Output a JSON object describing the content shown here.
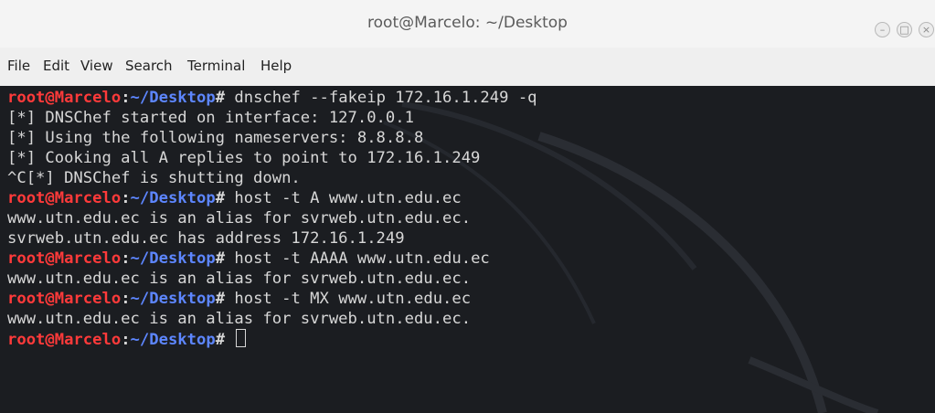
{
  "window": {
    "title": "root@Marcelo: ~/Desktop"
  },
  "controls": {
    "minimize_icon": "minimize-icon",
    "maximize_icon": "maximize-icon",
    "close_icon": "close-icon"
  },
  "menu": [
    "File",
    "Edit",
    "View",
    "Search",
    "Terminal",
    "Help"
  ],
  "prompt": {
    "user": "root@Marcelo",
    "sep": ":",
    "path": "~/Desktop",
    "symbol": "# "
  },
  "terminal": {
    "lines": [
      {
        "prompt": true,
        "text": "dnschef --fakeip 172.16.1.249 -q"
      },
      {
        "text": "[*] DNSChef started on interface: 127.0.0.1"
      },
      {
        "text": "[*] Using the following nameservers: 8.8.8.8"
      },
      {
        "text": "[*] Cooking all A replies to point to 172.16.1.249"
      },
      {
        "text": "^C[*] DNSChef is shutting down."
      },
      {
        "prompt": true,
        "text": "host -t A www.utn.edu.ec"
      },
      {
        "text": "www.utn.edu.ec is an alias for svrweb.utn.edu.ec."
      },
      {
        "text": "svrweb.utn.edu.ec has address 172.16.1.249"
      },
      {
        "prompt": true,
        "text": "host -t AAAA www.utn.edu.ec"
      },
      {
        "text": "www.utn.edu.ec is an alias for svrweb.utn.edu.ec."
      },
      {
        "prompt": true,
        "text": "host -t MX www.utn.edu.ec"
      },
      {
        "text": "www.utn.edu.ec is an alias for svrweb.utn.edu.ec."
      },
      {
        "prompt": true,
        "text": "",
        "cursor": true
      }
    ]
  },
  "colors": {
    "background": "#1b1d21",
    "text": "#d7d7d7",
    "prompt_user": "#ff3a3a",
    "prompt_path": "#5d86ff"
  }
}
